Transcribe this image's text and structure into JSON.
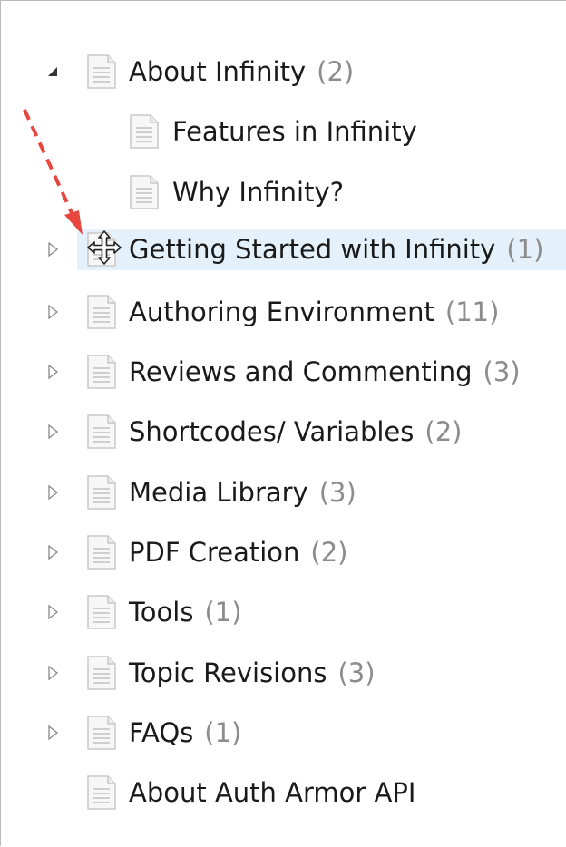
{
  "tree": {
    "items": [
      {
        "label": "About Infinity",
        "count": "(2)",
        "expander": "expanded"
      },
      {
        "label": "Features in Infinity",
        "count": ""
      },
      {
        "label": "Why Infinity?",
        "count": ""
      },
      {
        "label": "Getting Started with Infinity",
        "count": "(1)",
        "expander": "collapsed",
        "selected": true
      },
      {
        "label": "Authoring Environment",
        "count": "(11)",
        "expander": "collapsed"
      },
      {
        "label": "Reviews and Commenting",
        "count": "(3)",
        "expander": "collapsed"
      },
      {
        "label": "Shortcodes/ Variables",
        "count": "(2)",
        "expander": "collapsed"
      },
      {
        "label": "Media Library",
        "count": "(3)",
        "expander": "collapsed"
      },
      {
        "label": "PDF Creation",
        "count": "(2)",
        "expander": "collapsed"
      },
      {
        "label": "Tools",
        "count": "(1)",
        "expander": "collapsed"
      },
      {
        "label": "Topic Revisions",
        "count": "(3)",
        "expander": "collapsed"
      },
      {
        "label": "FAQs",
        "count": "(1)",
        "expander": "collapsed"
      },
      {
        "label": "About Auth Armor API",
        "count": ""
      }
    ]
  },
  "icons": {
    "document": "document-icon",
    "expanded": "triangle-down-icon",
    "collapsed": "triangle-right-icon",
    "drag_cursor": "move-cursor-icon",
    "annotation": "red-dashed-arrow-icon"
  },
  "colors": {
    "highlight": "#e5f1fa",
    "count_text": "#8c8c8c",
    "annotation_arrow": "#e8473f"
  }
}
